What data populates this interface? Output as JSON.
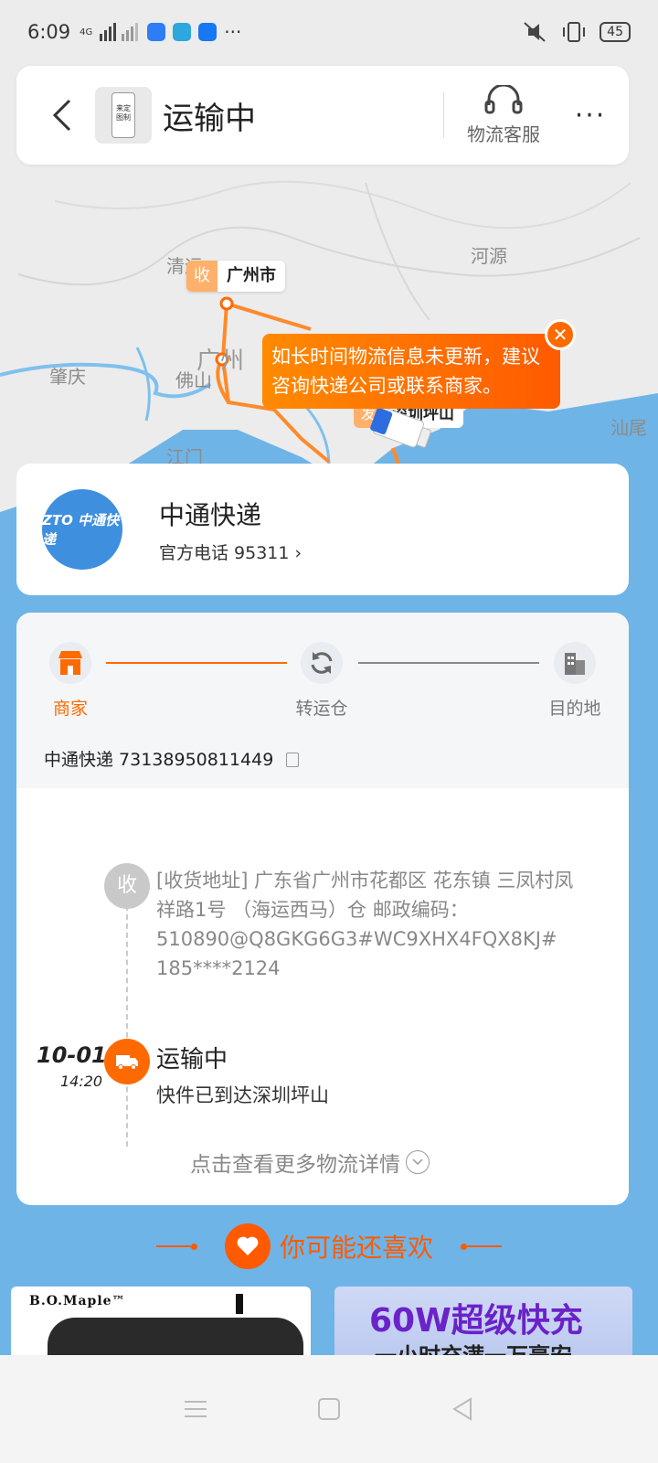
{
  "status_bar": {
    "time": "6:09",
    "network": "4G",
    "more": "···",
    "battery": "45"
  },
  "header": {
    "title": "运输中",
    "thumb_text_left": "来定",
    "thumb_text_right": "图制",
    "service_label": "物流客服",
    "more": "···"
  },
  "map": {
    "labels": [
      "清远",
      "河源",
      "肇庆",
      "佛山",
      "广州",
      "江门",
      "汕尾",
      "深圳"
    ],
    "receiver_tag": "收",
    "receiver_city": "广州市",
    "sender_tag": "发",
    "sender_city": "深圳坪山",
    "notice": "如长时间物流信息未更新，建议咨询快递公司或联系商家。",
    "close": "✕"
  },
  "carrier": {
    "logo_text": "ZTO 中通快递",
    "name": "中通快递",
    "phone": "官方电话 95311 ›"
  },
  "progress": {
    "steps": [
      {
        "label": "商家",
        "icon": "store-icon",
        "active": true
      },
      {
        "label": "转运仓",
        "icon": "refresh-icon",
        "active": false
      },
      {
        "label": "目的地",
        "icon": "building-icon",
        "active": false
      }
    ],
    "tracking_label": "中通快递 73138950811449"
  },
  "timeline": {
    "receiver_badge": "收",
    "receiver_address": "[收货地址] 广东省广州市花都区 花东镇 三凤村凤祥路1号 （海运西马）仓 邮政编码：510890@Q8GKG6G3#WC9XHX4FQX8KJ# 185****2124",
    "date": "10-01",
    "time": "14:20",
    "status_title": "运输中",
    "status_desc": "快件已到达深圳坪山",
    "more_link": "点击查看更多物流详情"
  },
  "recommend": {
    "title": "你可能还喜欢",
    "product1_brand": "B.O.Maple™",
    "product2_title": "60W超级快充",
    "product2_sub": "一小时充满一万毫安"
  },
  "colors": {
    "accent": "#ff6a00",
    "carrier_blue": "#3f8fdf",
    "sea": "#6fb4e6"
  }
}
